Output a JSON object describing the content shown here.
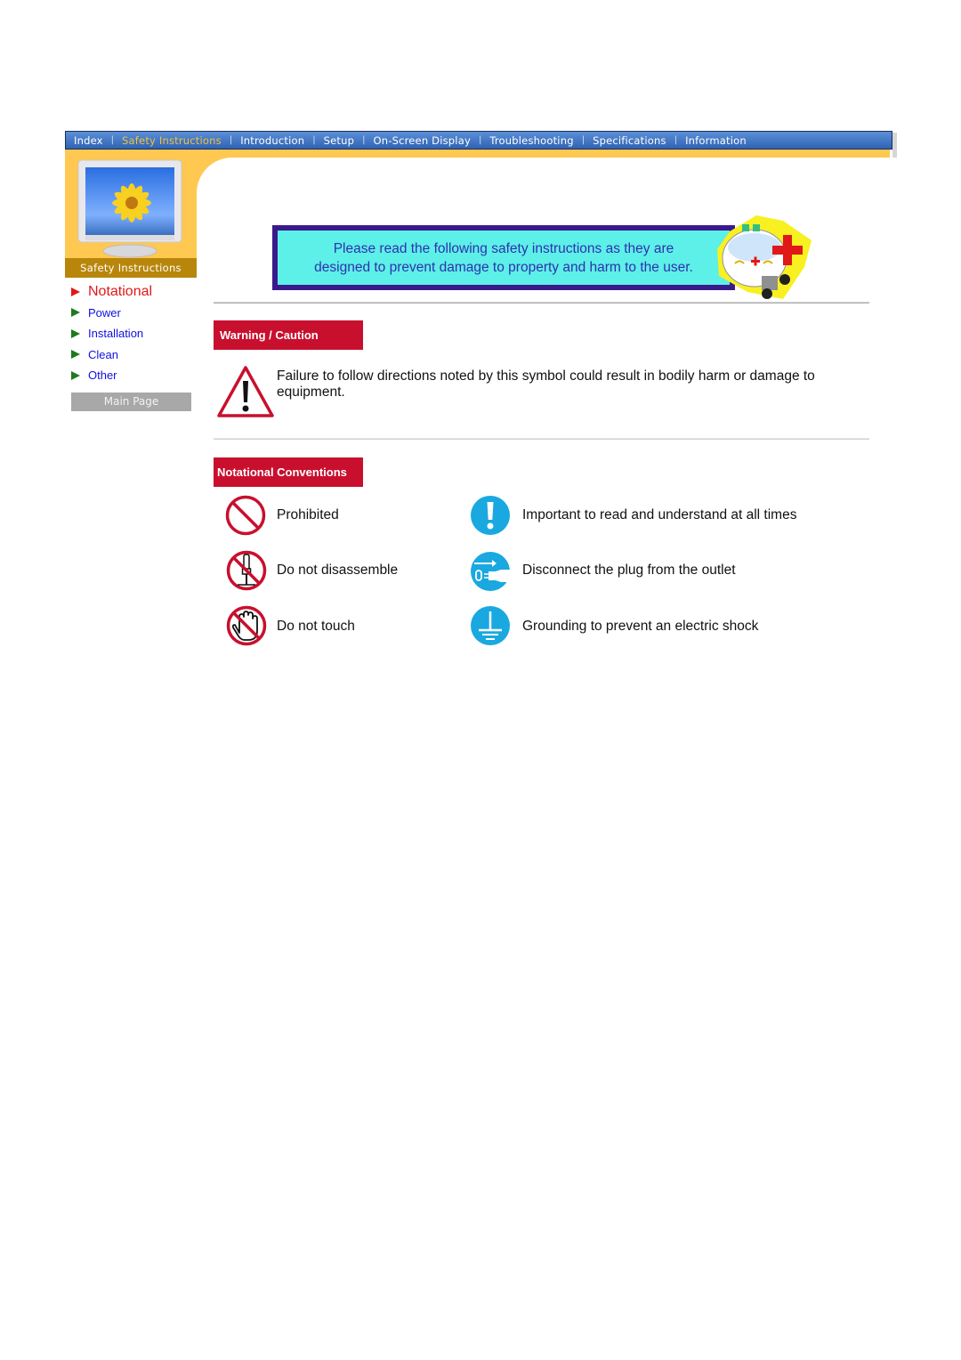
{
  "nav": {
    "items": [
      {
        "label": "Index",
        "active": false
      },
      {
        "label": "Safety Instructions",
        "active": true
      },
      {
        "label": "Introduction",
        "active": false
      },
      {
        "label": "Setup",
        "active": false
      },
      {
        "label": "On-Screen Display",
        "active": false
      },
      {
        "label": "Troubleshooting",
        "active": false
      },
      {
        "label": "Specifications",
        "active": false
      },
      {
        "label": "Information",
        "active": false
      }
    ],
    "separator": "|"
  },
  "sidebar": {
    "title": "Safety Instructions",
    "items": [
      {
        "label": "Notational",
        "active": true
      },
      {
        "label": "Power",
        "active": false
      },
      {
        "label": "Installation",
        "active": false
      },
      {
        "label": "Clean",
        "active": false
      },
      {
        "label": "Other",
        "active": false
      }
    ],
    "main_page_label": "Main Page"
  },
  "banner": {
    "line1": "Please read the following safety instructions as they are",
    "line2": "designed to prevent damage to property and harm to the user."
  },
  "warning": {
    "heading": "Warning / Caution",
    "icon": "warning-triangle-icon",
    "text": "Failure to follow directions noted by this symbol could result in bodily harm or damage to equipment."
  },
  "conventions": {
    "heading": "Notational Conventions",
    "items": [
      {
        "icon": "prohibited-icon",
        "label": "Prohibited"
      },
      {
        "icon": "important-icon",
        "label": "Important to read and understand at all times"
      },
      {
        "icon": "no-disassemble-icon",
        "label": "Do not disassemble"
      },
      {
        "icon": "unplug-icon",
        "label": "Disconnect the plug from the outlet"
      },
      {
        "icon": "no-touch-icon",
        "label": "Do not touch"
      },
      {
        "icon": "grounding-icon",
        "label": "Grounding to prevent an electric shock"
      }
    ]
  },
  "colors": {
    "nav_blue": "#2f62b4",
    "active_nav": "#f2c23a",
    "orange": "#ffc850",
    "section_red": "#c8102e",
    "prohibit_red": "#c8102e",
    "info_blue": "#1aa8e0",
    "banner_border": "#3a1a8a",
    "banner_fill": "#5cf0e8",
    "link_blue": "#1010e0",
    "active_red": "#e01818"
  }
}
